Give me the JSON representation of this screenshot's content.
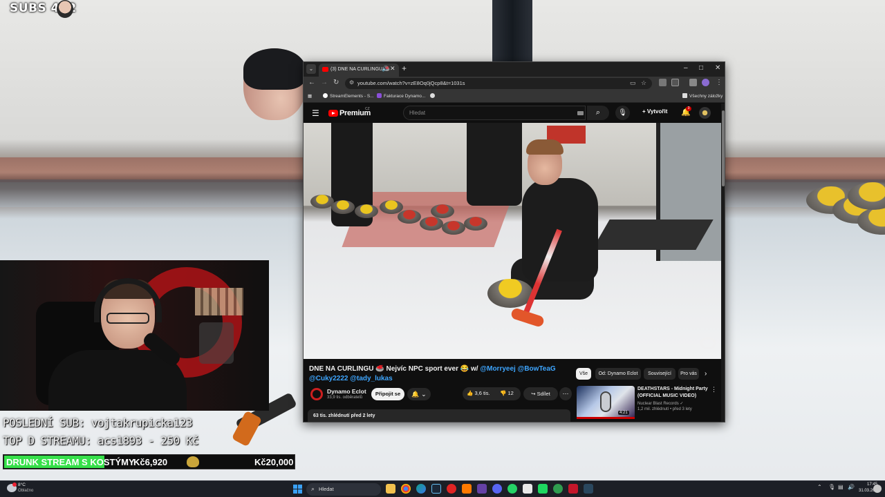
{
  "overlay": {
    "subs_label": "SUBS 452",
    "last_sub": "POSLEDNÍ SUB: vojtakrupicka123",
    "top_donation": "TOP D STREAMU: acs1893 - 250 Kč",
    "goal": {
      "title": "DRUNK STREAM S KOSTÝMY",
      "current": "Kč6,920",
      "target": "Kč20,000",
      "progress_fraction": 0.346
    }
  },
  "browser": {
    "tab_title": "(3) DNE NA CURLINGU 🥌",
    "url": "youtube.com/watch?v=zE8Oq0jQcp8&t=1031s",
    "bookmarks": [
      "StreamElements - S...",
      "Fakturace Dynamo..."
    ],
    "all_bookmarks": "Všechny záložky"
  },
  "youtube": {
    "brand": "Premium",
    "region": "CZ",
    "search_placeholder": "Hledat",
    "create_label": "Vytvořit",
    "notification_count": "3",
    "video": {
      "title": "DNE NA CURLINGU 🥌 Nejvíc NPC sport ever 😂 w/",
      "tags": [
        "@Morryeej",
        "@BowTeaG",
        "@Cuky2222",
        "@tady_lukas"
      ],
      "channel_name": "Dynamo Eclot",
      "channel_subs": "33,9 tis. odběratelů",
      "join_label": "Připojit se",
      "likes": "3,6 tis.",
      "comments": "12",
      "share_label": "Sdílet",
      "description_meta": "63 tis. zhlédnutí  před 2 lety"
    },
    "chips": [
      {
        "label": "Vše",
        "active": true
      },
      {
        "label": "Od: Dynamo Eclot",
        "active": false
      },
      {
        "label": "Související",
        "active": false
      },
      {
        "label": "Pro vás",
        "active": false
      }
    ],
    "recommendation": {
      "title": "DEATHSTARS - Midnight Party (OFFICIAL MUSIC VIDEO)",
      "channel": "Nuclear Blast Records ✓",
      "meta": "1,2 mil. zhlédnutí • před 3 lety",
      "duration": "4:21"
    }
  },
  "taskbar": {
    "weather_temp": "8°C",
    "weather_desc": "Oblačno",
    "search_label": "Hledat",
    "time": "17:45",
    "date": "31.03.2026"
  },
  "colors": {
    "youtube_red": "#ff0000",
    "goal_green": "#36e04a",
    "link_blue": "#3ea6ff",
    "taskbar": "#1c1f26"
  }
}
